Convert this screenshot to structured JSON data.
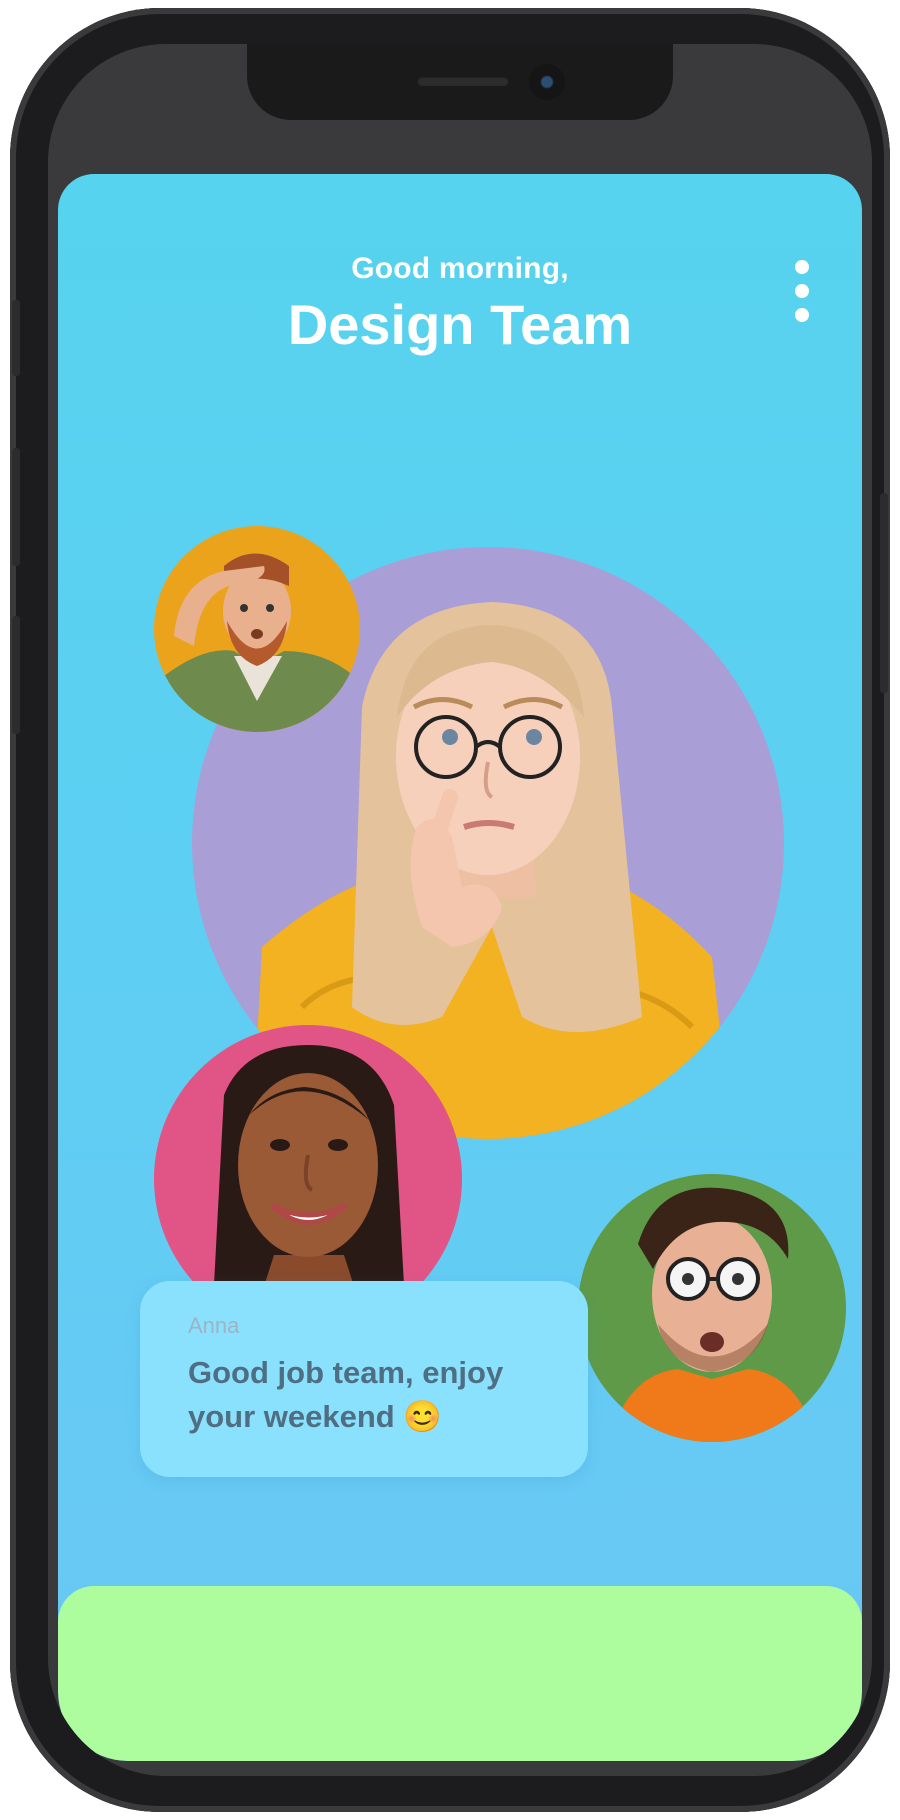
{
  "header": {
    "greeting": "Good morning,",
    "title": "Design Team",
    "menu_icon": "more-vertical-icon"
  },
  "participants": [
    {
      "role": "main",
      "color": "#aa9ed6"
    },
    {
      "role": "top-left",
      "color": "#eba31c"
    },
    {
      "role": "left",
      "color": "#e15486"
    },
    {
      "role": "right",
      "color": "#5f9a48"
    }
  ],
  "message": {
    "sender": "Anna",
    "text": "Good job team, enjoy your weekend 😊"
  },
  "colors": {
    "screen_background": "#56d3ee",
    "bubble_background": "#8ae1fd",
    "bottom_panel": "#adfc9e"
  }
}
